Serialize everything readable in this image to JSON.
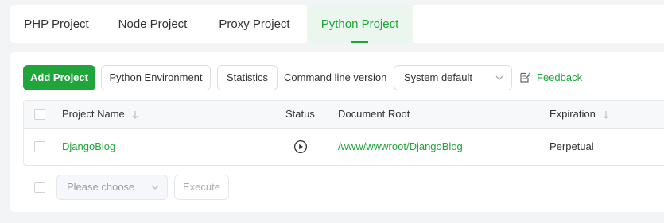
{
  "tabs": [
    {
      "label": "PHP Project"
    },
    {
      "label": "Node Project"
    },
    {
      "label": "Proxy Project"
    },
    {
      "label": "Python Project",
      "active": true
    }
  ],
  "toolbar": {
    "add_project": "Add Project",
    "python_environment": "Python Environment",
    "statistics": "Statistics",
    "command_line_label": "Command line version",
    "command_line_value": "System default",
    "feedback": "Feedback"
  },
  "table": {
    "columns": {
      "project_name": "Project Name",
      "status": "Status",
      "document_root": "Document Root",
      "expiration": "Expiration"
    },
    "rows": [
      {
        "project_name": "DjangoBlog",
        "status_icon": "play-icon",
        "document_root": "/www/wwwroot/DjangoBlog",
        "expiration": "Perpetual"
      }
    ]
  },
  "batch": {
    "placeholder": "Please choose",
    "execute": "Execute"
  },
  "colors": {
    "accent": "#20a53a",
    "background": "#f2f4f5"
  }
}
